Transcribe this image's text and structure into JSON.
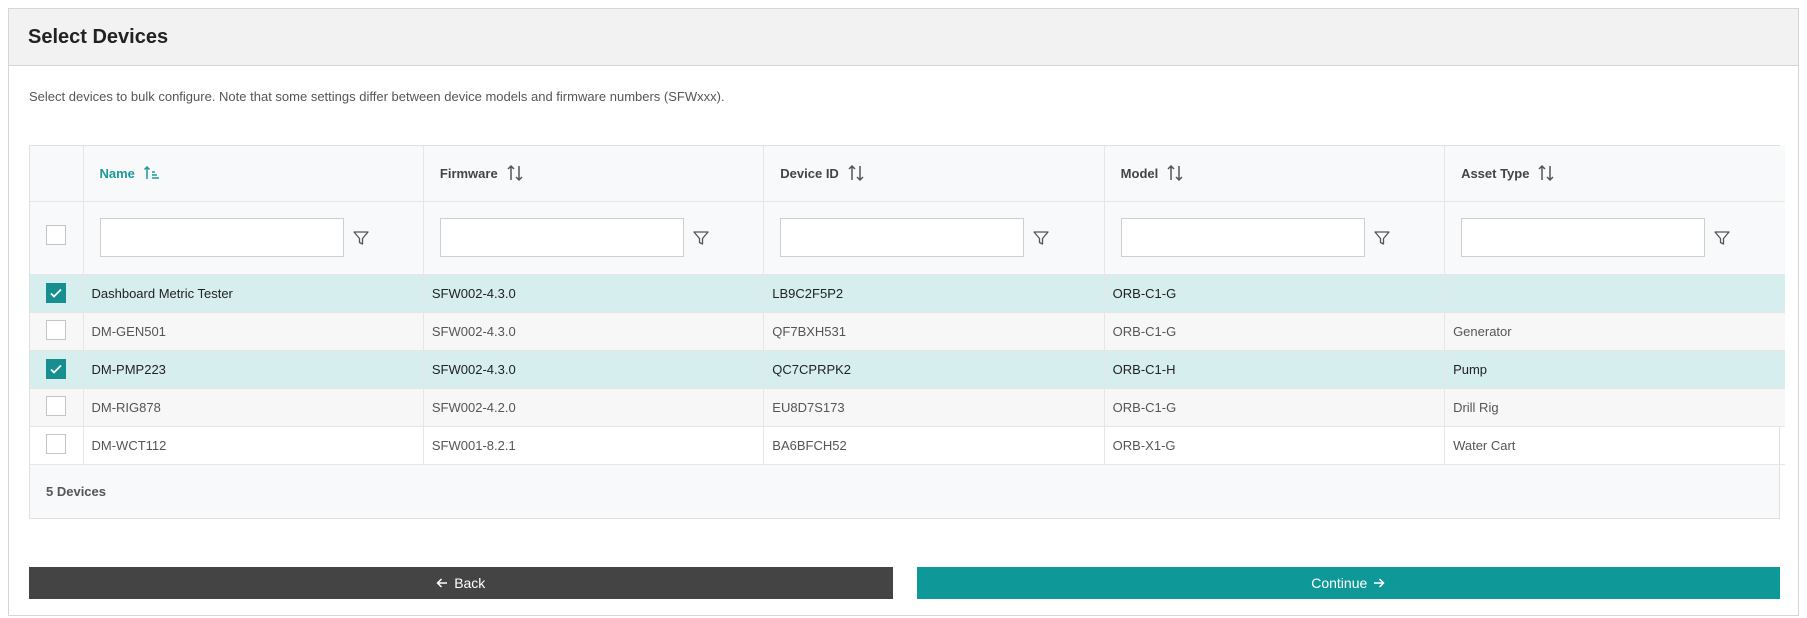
{
  "panel": {
    "title": "Select Devices",
    "description": "Select devices to bulk configure. Note that some settings differ between device models and firmware numbers (SFWxxx)."
  },
  "table": {
    "columns": [
      {
        "key": "name",
        "label": "Name",
        "sorted": true
      },
      {
        "key": "firmware",
        "label": "Firmware",
        "sorted": false
      },
      {
        "key": "device_id",
        "label": "Device ID",
        "sorted": false
      },
      {
        "key": "model",
        "label": "Model",
        "sorted": false
      },
      {
        "key": "asset_type",
        "label": "Asset Type",
        "sorted": false
      }
    ],
    "filters": {
      "name": "",
      "firmware": "",
      "device_id": "",
      "model": "",
      "asset_type": ""
    },
    "select_all_checked": false,
    "rows": [
      {
        "checked": true,
        "name": "Dashboard Metric Tester",
        "firmware": "SFW002-4.3.0",
        "device_id": "LB9C2F5P2",
        "model": "ORB-C1-G",
        "asset_type": ""
      },
      {
        "checked": false,
        "name": "DM-GEN501",
        "firmware": "SFW002-4.3.0",
        "device_id": "QF7BXH531",
        "model": "ORB-C1-G",
        "asset_type": "Generator"
      },
      {
        "checked": true,
        "name": "DM-PMP223",
        "firmware": "SFW002-4.3.0",
        "device_id": "QC7CPRPK2",
        "model": "ORB-C1-H",
        "asset_type": "Pump"
      },
      {
        "checked": false,
        "name": "DM-RIG878",
        "firmware": "SFW002-4.2.0",
        "device_id": "EU8D7S173",
        "model": "ORB-C1-G",
        "asset_type": "Drill Rig"
      },
      {
        "checked": false,
        "name": "DM-WCT112",
        "firmware": "SFW001-8.2.1",
        "device_id": "BA6BFCH52",
        "model": "ORB-X1-G",
        "asset_type": "Water Cart"
      }
    ],
    "footer": "5 Devices"
  },
  "buttons": {
    "back_label": "Back",
    "continue_label": "Continue"
  },
  "colors": {
    "accent": "#0f9898",
    "selected_row": "#d6eeee",
    "back_button": "#444444"
  },
  "icons": {
    "sort": "sort-icon",
    "sort_active": "sort-ascending-icon",
    "filter": "filter-icon",
    "back": "arrow-left-icon",
    "continue": "arrow-right-icon",
    "check": "check-icon"
  }
}
